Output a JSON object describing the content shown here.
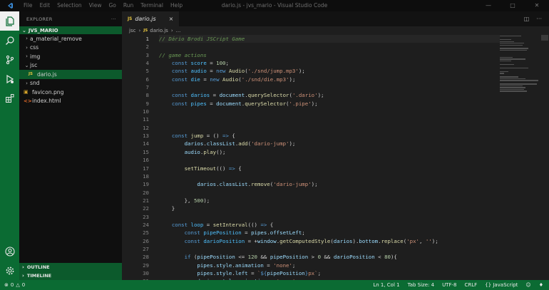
{
  "window": {
    "title": "dario.js - jvs_mario - Visual Studio Code",
    "menu": [
      "File",
      "Edit",
      "Selection",
      "View",
      "Go",
      "Run",
      "Terminal",
      "Help"
    ]
  },
  "sidebar": {
    "header": "EXPLORER",
    "project": "JVS_MARIO",
    "items": [
      {
        "label": "a_material_remove",
        "kind": "folder",
        "open": false
      },
      {
        "label": "css",
        "kind": "folder",
        "open": false
      },
      {
        "label": "img",
        "kind": "folder",
        "open": false
      },
      {
        "label": "jsc",
        "kind": "folder",
        "open": true
      },
      {
        "label": "dario.js",
        "kind": "js"
      },
      {
        "label": "snd",
        "kind": "folder",
        "open": false
      },
      {
        "label": "favicon.png",
        "kind": "image"
      },
      {
        "label": "index.html",
        "kind": "html"
      }
    ],
    "panels": [
      "OUTLINE",
      "TIMELINE"
    ]
  },
  "tab": {
    "icon": "JS",
    "label": "dario.js",
    "close": "×"
  },
  "breadcrumb": {
    "folder": "jsc",
    "file": "dario.js",
    "more": "..."
  },
  "code": {
    "lines": [
      "1",
      "2",
      "3",
      "4",
      "5",
      "6",
      "7",
      "8",
      "9",
      "10",
      "11",
      "12",
      "13",
      "14",
      "15",
      "16",
      "17",
      "18",
      "19",
      "20",
      "21",
      "22",
      "23",
      "24",
      "25",
      "26",
      "27",
      "28",
      "29",
      "30",
      "31",
      "32"
    ]
  },
  "status": {
    "errors": "0",
    "warnings": "0",
    "position": "Ln 1, Col 1",
    "tabsize": "Tab Size: 4",
    "encoding": "UTF-8",
    "eol": "CRLF",
    "language": "JavaScript"
  },
  "colors": {
    "accent": "#0b6b33",
    "editor_bg": "#1e1e1e"
  }
}
